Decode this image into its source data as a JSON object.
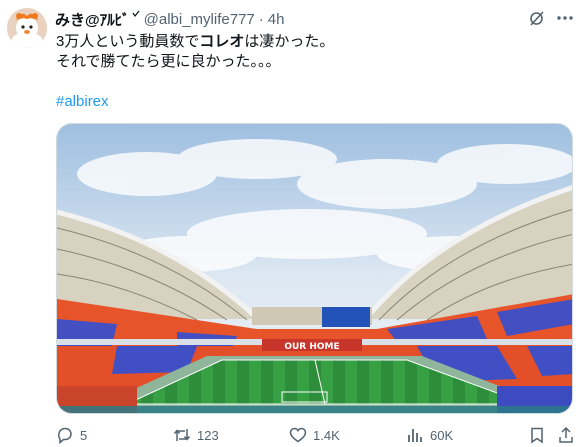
{
  "author": {
    "display_name": "みき@ｱﾙﾋﾞ",
    "verified_mark": "v",
    "handle": "@albi_mylife777",
    "separator": "·",
    "time": "4h",
    "avatar_icon": "avatar-orange-mascot"
  },
  "post": {
    "line1_pre": "3万人という動員数で",
    "line1_bold": "コレオ",
    "line1_post": "は凄かった。",
    "line2": "それで勝てたら更に良かった。。。",
    "hashtag": "#albirex"
  },
  "media": {
    "banner_text": "OUR HOME",
    "description_icon": "stadium-photo"
  },
  "actions": {
    "replies": "5",
    "reposts": "123",
    "likes": "1.4K",
    "views": "60K"
  },
  "colors": {
    "link": "#1d9bf0",
    "secondary_text": "#536471",
    "primary_text": "#0f1419",
    "choreo_orange": "#e8542a",
    "choreo_blue": "#3b4fc9"
  }
}
